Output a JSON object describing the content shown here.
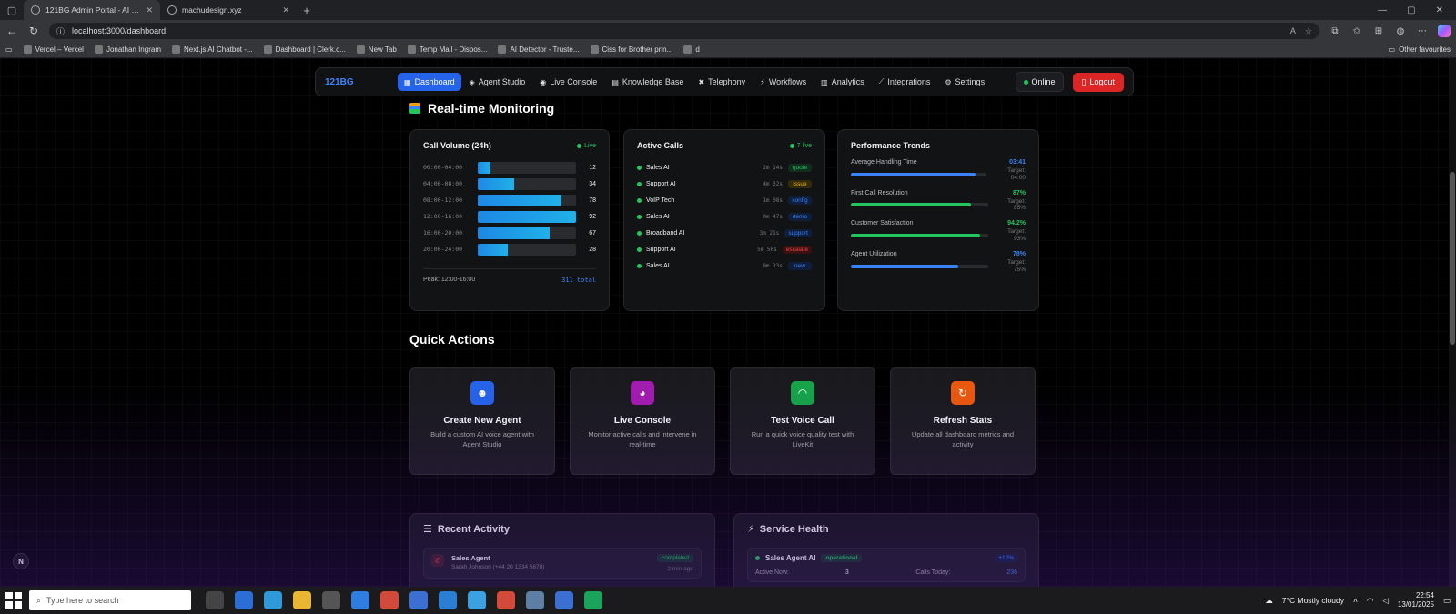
{
  "browser": {
    "tabs": [
      {
        "title": "121BG Admin Portal - AI Voice Ag",
        "active": true
      },
      {
        "title": "machudesign.xyz",
        "active": false
      }
    ],
    "url": "localhost:3000/dashboard",
    "bookmarks": [
      "Vercel – Vercel",
      "Jonathan Ingram",
      "Next.js AI Chatbot -...",
      "Dashboard | Clerk.c...",
      "New Tab",
      "Temp Mail - Dispos...",
      "AI Detector - Truste...",
      "Ciss for Brother prin...",
      "d"
    ],
    "other_favourites": "Other favourites"
  },
  "nav": {
    "brand": "121BG",
    "items": [
      {
        "label": "Dashboard",
        "icon": "▦",
        "active": true
      },
      {
        "label": "Agent Studio",
        "icon": "◈"
      },
      {
        "label": "Live Console",
        "icon": "◉"
      },
      {
        "label": "Knowledge Base",
        "icon": "▤"
      },
      {
        "label": "Telephony",
        "icon": "✖"
      },
      {
        "label": "Workflows",
        "icon": "⚡"
      },
      {
        "label": "Analytics",
        "icon": "▥"
      },
      {
        "label": "Integrations",
        "icon": "⟋"
      },
      {
        "label": "Settings",
        "icon": "⚙"
      }
    ],
    "status": "Online",
    "logout": "Logout"
  },
  "monitoring": {
    "title": "Real-time Monitoring",
    "call_volume": {
      "title": "Call Volume (24h)",
      "live": "Live",
      "rows": [
        {
          "range": "00:00-04:00",
          "value": 12
        },
        {
          "range": "04:00-08:00",
          "value": 34
        },
        {
          "range": "08:00-12:00",
          "value": 78
        },
        {
          "range": "12:00-16:00",
          "value": 92
        },
        {
          "range": "16:00-20:00",
          "value": 67
        },
        {
          "range": "20:00-24:00",
          "value": 28
        }
      ],
      "peak": "Peak: 12:00-16:00",
      "total": "311 total"
    },
    "active_calls": {
      "title": "Active Calls",
      "live": "7 live",
      "rows": [
        {
          "name": "Sales AI",
          "time": "2m 14s",
          "tag": "quote",
          "tag_color": "#22c55e",
          "tag_bg": "#10301d"
        },
        {
          "name": "Support AI",
          "time": "4m 32s",
          "tag": "issue",
          "tag_color": "#eab308",
          "tag_bg": "#332a0a"
        },
        {
          "name": "VoIP Tech",
          "time": "1m 08s",
          "tag": "config",
          "tag_color": "#3b82f6",
          "tag_bg": "#0f1e3a"
        },
        {
          "name": "Sales AI",
          "time": "0m 47s",
          "tag": "demo",
          "tag_color": "#3b82f6",
          "tag_bg": "#0f1e3a"
        },
        {
          "name": "Broadband AI",
          "time": "3m 21s",
          "tag": "support",
          "tag_color": "#3b82f6",
          "tag_bg": "#0f1e3a"
        },
        {
          "name": "Support AI",
          "time": "5m 56s",
          "tag": "escalate",
          "tag_color": "#ef4444",
          "tag_bg": "#3a1010"
        },
        {
          "name": "Sales AI",
          "time": "0m 23s",
          "tag": "new",
          "tag_color": "#3b82f6",
          "tag_bg": "#0f1e3a"
        }
      ]
    },
    "performance": {
      "title": "Performance Trends",
      "metrics": [
        {
          "label": "Average Handling Time",
          "value": "03:41",
          "target": "Target: 04:00",
          "fill": 0.92,
          "color": "#3b82f6"
        },
        {
          "label": "First Call Resolution",
          "value": "87%",
          "target": "Target: 85%",
          "fill": 0.87,
          "color": "#22c55e"
        },
        {
          "label": "Customer Satisfaction",
          "value": "94.2%",
          "target": "Target: 93%",
          "fill": 0.94,
          "color": "#22c55e"
        },
        {
          "label": "Agent Utilization",
          "value": "78%",
          "target": "Target: 75%",
          "fill": 0.78,
          "color": "#3b82f6"
        }
      ]
    }
  },
  "quick_actions": {
    "title": "Quick Actions",
    "cards": [
      {
        "title": "Create New Agent",
        "desc": "Build a custom AI voice agent with Agent Studio",
        "icon": "robot-icon",
        "glyph": "☻",
        "color": "#2563eb"
      },
      {
        "title": "Live Console",
        "desc": "Monitor active calls and intervene in real-time",
        "icon": "console-icon",
        "glyph": "◕",
        "color": "#a21caf"
      },
      {
        "title": "Test Voice Call",
        "desc": "Run a quick voice quality test with LiveKit",
        "icon": "headset-icon",
        "glyph": "◠",
        "color": "#16a34a"
      },
      {
        "title": "Refresh Stats",
        "desc": "Update all dashboard metrics and activity",
        "icon": "refresh-icon",
        "glyph": "↻",
        "color": "#ea580c"
      }
    ]
  },
  "recent_activity": {
    "title": "Recent Activity",
    "item": {
      "name": "Sales Agent",
      "detail": "Sarah Johnson (+44 20 1234 5678)",
      "status": "completed",
      "time": "2 min ago"
    }
  },
  "service_health": {
    "title": "Service Health",
    "item": {
      "name": "Sales Agent AI",
      "status": "operational",
      "delta": "+12%",
      "active_label": "Active Now:",
      "active_value": "3",
      "calls_label": "Calls Today:",
      "calls_value": "236"
    }
  },
  "taskbar": {
    "search_placeholder": "Type here to search",
    "weather": "7°C  Mostly cloudy",
    "time": "22:54",
    "date": "13/01/2025"
  }
}
